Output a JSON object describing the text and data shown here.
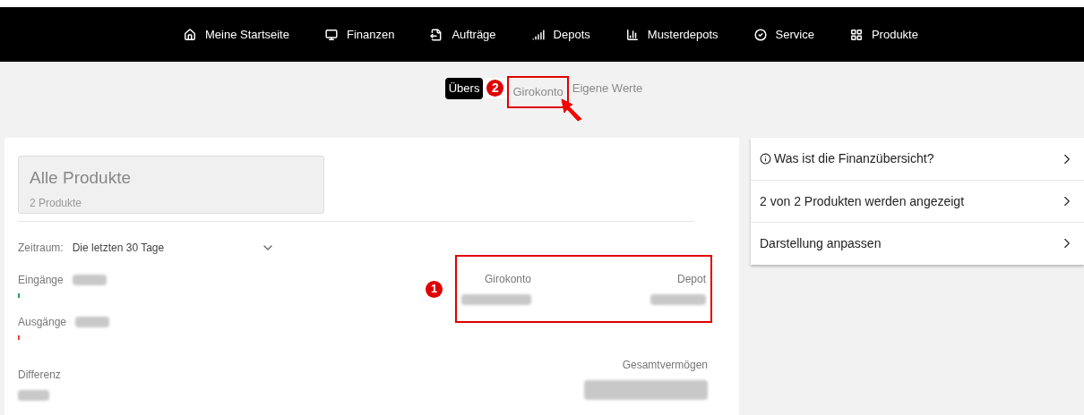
{
  "nav": [
    {
      "label": "Meine Startseite"
    },
    {
      "label": "Finanzen"
    },
    {
      "label": "Aufträge"
    },
    {
      "label": "Depots"
    },
    {
      "label": "Musterdepots"
    },
    {
      "label": "Service"
    },
    {
      "label": "Produkte"
    }
  ],
  "subtabs": [
    {
      "label": "Übers",
      "selected": true,
      "highlighted": false
    },
    {
      "label": "Girokonto",
      "selected": false,
      "highlighted": true
    },
    {
      "label": "Eigene Werte",
      "selected": false,
      "highlighted": false
    }
  ],
  "marker_tabs": "2",
  "product_selector": {
    "title": "Alle Produkte",
    "subtitle": "2 Produkte"
  },
  "period": {
    "label": "Zeitraum:",
    "value": "Die letzten 30 Tage"
  },
  "flows": [
    {
      "label": "Eingänge",
      "color": "#2e9e5b"
    },
    {
      "label": "Ausgänge",
      "color": "#e4432f"
    }
  ],
  "difference": {
    "label": "Differenz"
  },
  "marker_accounts": "1",
  "accounts": [
    {
      "label": "Girokonto"
    },
    {
      "label": "Depot"
    }
  ],
  "total": {
    "label": "Gesamtvermögen"
  },
  "side_menu": [
    {
      "label": "Was ist die Finanzübersicht?",
      "info": true
    },
    {
      "label": "2 von 2 Produkten werden angezeigt",
      "info": false
    },
    {
      "label": "Darstellung anpassen",
      "info": false
    }
  ]
}
